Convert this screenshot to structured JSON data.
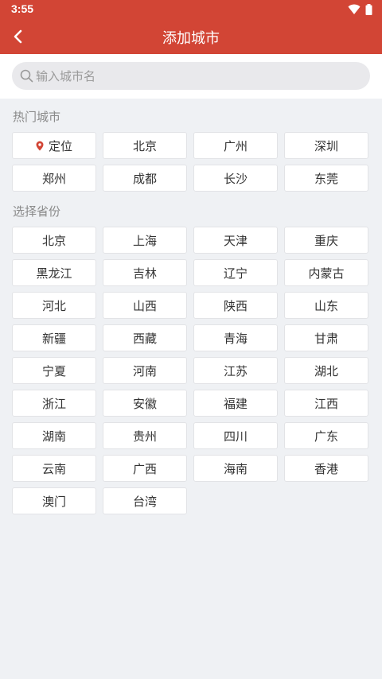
{
  "status_bar": {
    "time": "3:55"
  },
  "app_bar": {
    "title": "添加城市"
  },
  "search": {
    "placeholder": "输入城市名",
    "value": ""
  },
  "hot_cities": {
    "title": "热门城市",
    "location_label": "定位",
    "items": [
      "北京",
      "广州",
      "深圳",
      "郑州",
      "成都",
      "长沙",
      "东莞"
    ]
  },
  "provinces": {
    "title": "选择省份",
    "items": [
      "北京",
      "上海",
      "天津",
      "重庆",
      "黑龙江",
      "吉林",
      "辽宁",
      "内蒙古",
      "河北",
      "山西",
      "陕西",
      "山东",
      "新疆",
      "西藏",
      "青海",
      "甘肃",
      "宁夏",
      "河南",
      "江苏",
      "湖北",
      "浙江",
      "安徽",
      "福建",
      "江西",
      "湖南",
      "贵州",
      "四川",
      "广东",
      "云南",
      "广西",
      "海南",
      "香港",
      "澳门",
      "台湾"
    ]
  },
  "colors": {
    "primary": "#d24535",
    "background": "#eff1f4",
    "location_pin": "#d24535"
  }
}
